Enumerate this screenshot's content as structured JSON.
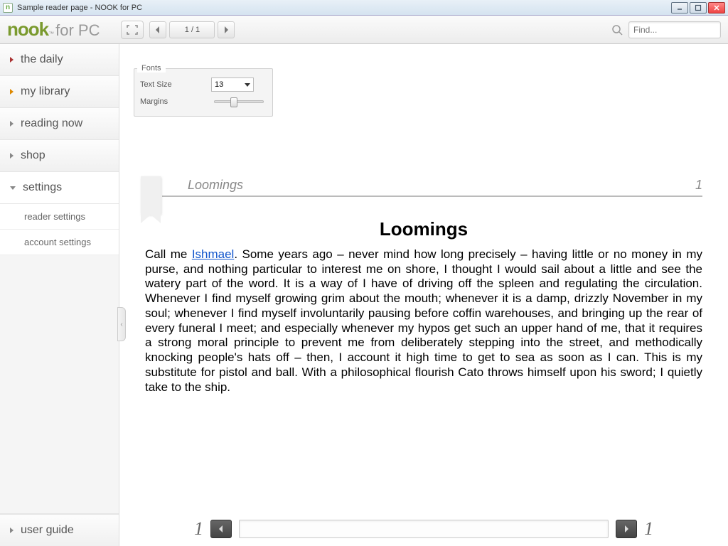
{
  "titlebar": {
    "text": "Sample reader page - NOOK for PC"
  },
  "logo": {
    "brand": "nook",
    "suffix": "for PC"
  },
  "toolbar": {
    "page_indicator": "1 / 1"
  },
  "search": {
    "placeholder": "Find..."
  },
  "sidebar": {
    "items": [
      {
        "label": "the daily"
      },
      {
        "label": "my library"
      },
      {
        "label": "reading now"
      },
      {
        "label": "shop"
      },
      {
        "label": "settings"
      }
    ],
    "sub": [
      {
        "label": "reader settings"
      },
      {
        "label": "account settings"
      }
    ],
    "bottom": {
      "label": "user guide"
    }
  },
  "fonts": {
    "title": "Fonts",
    "text_size_label": "Text Size",
    "text_size_value": "13",
    "margins_label": "Margins"
  },
  "reader": {
    "header_title": "Loomings",
    "header_page": "1",
    "chapter_title": "Loomings",
    "para_start": "Call me ",
    "para_link": "Ishmael",
    "para_rest": ". Some years ago – never mind how long precisely – having little or no money in my purse, and nothing particular to interest me on shore, I thought I would sail about a little and see the watery part of the word. It is a way of I have of driving off the spleen and regulating the circulation. Whenever I find myself growing grim about the mouth; whenever it is a damp, drizzly November in my soul; whenever I find myself involuntarily pausing before coffin warehouses, and bringing up the rear of every funeral I meet; and especially whenever my hypos get such an upper hand of me, that it requires a strong moral principle to prevent me from deliberately stepping into the street, and methodically knocking people's hats off – then, I account it high time to get to sea as soon as I can. This is my substitute for pistol and ball. With a philosophical flourish Cato throws himself upon his sword; I quietly take to the ship."
  },
  "bottom_nav": {
    "left_page": "1",
    "right_page": "1"
  }
}
